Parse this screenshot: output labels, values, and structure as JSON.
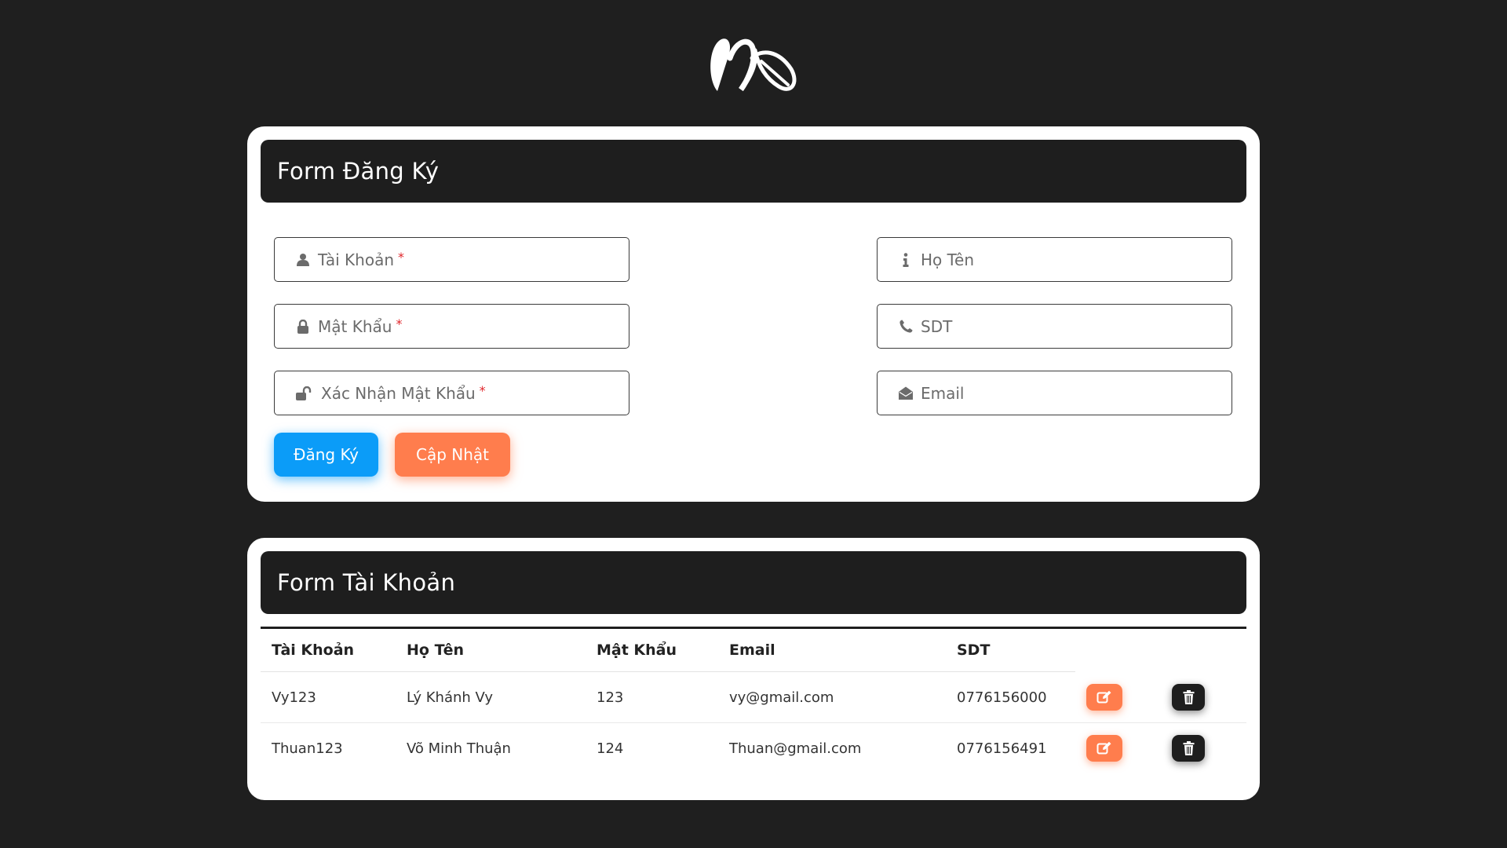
{
  "logo": {
    "name": "brand-logo"
  },
  "register": {
    "title": "Form Đăng Ký",
    "fields": {
      "username": {
        "placeholder": "Tài Khoản",
        "required": "*",
        "icon": "user-icon"
      },
      "password": {
        "placeholder": "Mật Khẩu",
        "required": "*",
        "icon": "lock-icon"
      },
      "confirm": {
        "placeholder": "Xác Nhận Mật Khẩu",
        "required": "*",
        "icon": "unlock-icon"
      },
      "fullname": {
        "placeholder": "Họ Tên",
        "icon": "info-icon"
      },
      "phone": {
        "placeholder": "SDT",
        "icon": "phone-icon"
      },
      "email": {
        "placeholder": "Email",
        "icon": "envelope-open-icon"
      }
    },
    "buttons": {
      "register": "Đăng Ký",
      "update": "Cập Nhật"
    },
    "colors": {
      "register": "#0b9cf8",
      "update": "#ff7d4d"
    }
  },
  "accounts": {
    "title": "Form Tài Khoản",
    "headers": [
      "Tài Khoản",
      "Họ Tên",
      "Mật Khẩu",
      "Email",
      "SDT"
    ],
    "rows": [
      {
        "username": "Vy123",
        "fullname": "Lý Khánh Vy",
        "password": "123",
        "email": "vy@gmail.com",
        "phone": "0776156000"
      },
      {
        "username": "Thuan123",
        "fullname": "Võ Minh Thuận",
        "password": "124",
        "email": "Thuan@gmail.com",
        "phone": "0776156491"
      }
    ]
  }
}
